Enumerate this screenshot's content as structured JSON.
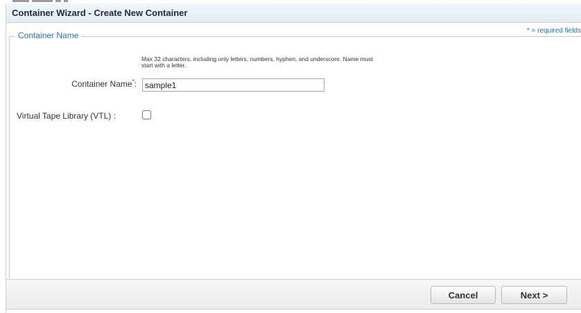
{
  "dialog": {
    "title": "Container Wizard - Create New Container",
    "required_note": "* = required fields"
  },
  "section": {
    "legend": "Container Name",
    "hint": "Max 32 characters, including only letters, numbers, hyphen, and underscore. Name must start with a letter.",
    "name_label": "Container Name",
    "name_required_mark": "*",
    "name_colon": ":",
    "name_value": "sample1",
    "vtl_label": "Virtual Tape Library (VTL) :",
    "vtl_checked": false
  },
  "footer": {
    "cancel_label": "Cancel",
    "next_label": "Next >"
  }
}
